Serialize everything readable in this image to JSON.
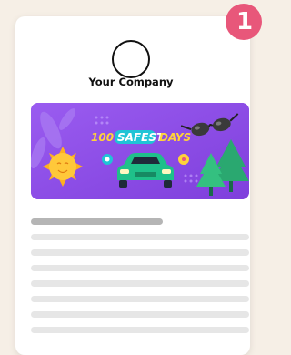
{
  "badge": {
    "number": "1"
  },
  "company": {
    "name": "Your Company"
  },
  "banner": {
    "title_part1": "100",
    "title_part2": "SAFEST",
    "title_part3": "DAYS",
    "colors": {
      "background": "#8c4fe6",
      "title_highlight": "#1fc4d6",
      "title_text": "#ffd23a",
      "car": "#1fc08a"
    }
  },
  "colors": {
    "badge": "#e8577a",
    "page_background": "#f6efe6",
    "skeleton_dark": "#b5b5b5",
    "skeleton_light": "#e6e6e6"
  }
}
